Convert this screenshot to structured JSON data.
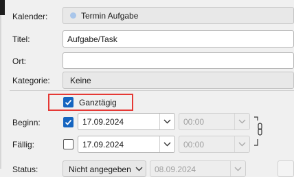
{
  "form": {
    "calendar": {
      "label": "Kalender:",
      "value": "Termin Aufgabe"
    },
    "title": {
      "label": "Titel:",
      "value": "Aufgabe/Task"
    },
    "location": {
      "label": "Ort:",
      "value": ""
    },
    "category": {
      "label": "Kategorie:",
      "value": "Keine"
    },
    "all_day": {
      "label": "Ganztägig",
      "checked": true
    },
    "start": {
      "label": "Beginn:",
      "checked": true,
      "date": "17.09.2024",
      "time": "00:00"
    },
    "due": {
      "label": "Fällig:",
      "checked": false,
      "date": "17.09.2024",
      "time": "00:00"
    },
    "status": {
      "label": "Status:",
      "value": "Nicht angegeben",
      "date": "08.09.2024"
    }
  },
  "colors": {
    "accent": "#1565c0",
    "highlight": "#e53935",
    "calendar_dot": "#a9c6ea"
  },
  "icons": {
    "dropdown": "chevron-down-icon",
    "link": "chain-link-icon",
    "check": "checkmark-icon"
  }
}
